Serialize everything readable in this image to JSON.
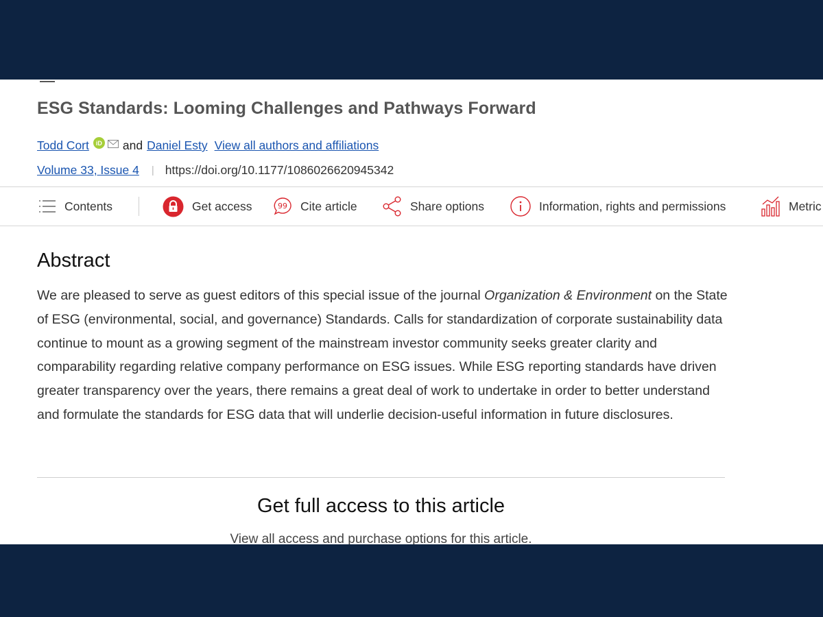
{
  "article": {
    "title": "ESG Standards: Looming Challenges and Pathways Forward",
    "authors": [
      {
        "name": "Todd Cort",
        "orcid_badge": "iD"
      },
      {
        "name": "Daniel Esty"
      }
    ],
    "and_text": "and",
    "view_all_authors": "View all authors and affiliations",
    "volume_issue": "Volume 33, Issue 4",
    "separator": "|",
    "doi": "https://doi.org/10.1177/1086026620945342"
  },
  "toolbar": {
    "items": [
      {
        "label": "Contents",
        "icon": "list-icon"
      },
      {
        "label": "Get access",
        "icon": "lock-icon"
      },
      {
        "label": "Cite article",
        "icon": "quote-icon"
      },
      {
        "label": "Share options",
        "icon": "share-icon"
      },
      {
        "label": "Information, rights and permissions",
        "icon": "info-icon"
      },
      {
        "label": "Metric",
        "icon": "metrics-icon"
      }
    ]
  },
  "abstract": {
    "heading": "Abstract",
    "text_before_journal": "We are pleased to serve as guest editors of this special issue of the journal ",
    "journal": "Organization & Environment",
    "text_after_journal": " on the State of ESG (environmental, social, and governance) Standards. Calls for standardization of corporate sustainability data continue to mount as a growing segment of the mainstream investor community seeks greater clarity and comparability regarding relative company performance on ESG issues. While ESG reporting standards have driven greater transparency over the years, there remains a great deal of work to undertake in order to better understand and formulate the standards for ESG data that will underlie decision-useful information in future disclosures."
  },
  "access": {
    "heading": "Get full access to this article",
    "subtext": "View all access and purchase options for this article."
  },
  "colors": {
    "frame": "#0d2341",
    "link": "#1a55b0",
    "accent_red": "#d9262e",
    "orcid_green": "#a6ce39"
  }
}
